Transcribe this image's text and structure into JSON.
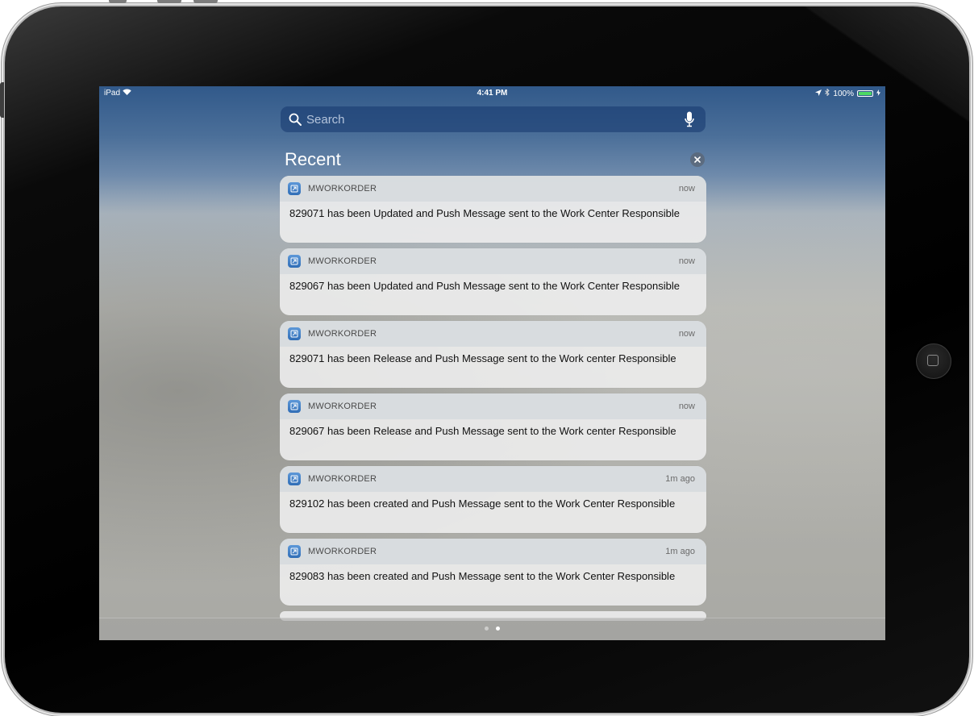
{
  "status_bar": {
    "device_label": "iPad",
    "time": "4:41 PM",
    "battery_text": "100%",
    "battery_level": 1.0
  },
  "search": {
    "placeholder": "Search",
    "icon": "search-icon",
    "mic_icon": "microphone-icon"
  },
  "recent": {
    "title": "Recent",
    "clear_icon": "close-icon"
  },
  "notifications": [
    {
      "app": "MWORKORDER",
      "time": "now",
      "message": "829071 has been Updated and Push Message sent to the Work Center Responsible"
    },
    {
      "app": "MWORKORDER",
      "time": "now",
      "message": "829067 has been Updated and Push Message sent to the Work Center Responsible"
    },
    {
      "app": "MWORKORDER",
      "time": "now",
      "message": "829071 has been Release and Push Message sent to the Work center Responsible"
    },
    {
      "app": "MWORKORDER",
      "time": "now",
      "message": "829067 has been Release and Push Message sent to the Work center Responsible"
    },
    {
      "app": "MWORKORDER",
      "time": "1m ago",
      "message": "829102 has been created and Push Message sent to the Work Center Responsible"
    },
    {
      "app": "MWORKORDER",
      "time": "1m ago",
      "message": "829083 has been created and Push Message sent to the Work Center Responsible"
    }
  ],
  "page_indicator": {
    "count": 2,
    "active_index": 1
  },
  "colors": {
    "battery_fill": "#4cd964",
    "app_icon": "#3b7ec6"
  }
}
